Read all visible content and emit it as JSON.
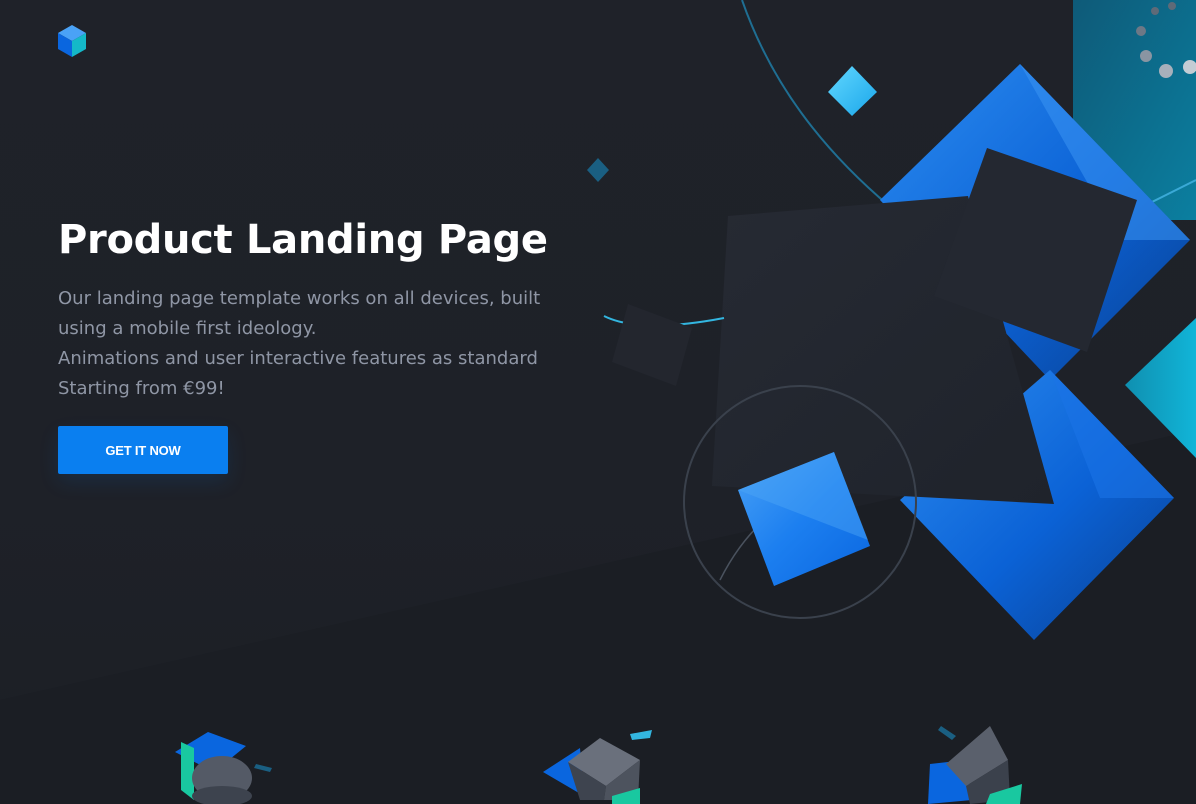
{
  "hero": {
    "title": "Product Landing Page",
    "lines": [
      "Our landing page template works on all devices, built",
      "using a mobile first ideology.",
      "Animations and user interactive features as standard",
      "Starting from €99!"
    ],
    "cta_label": "GET IT NOW"
  },
  "theme": {
    "background": "#1d2026",
    "accent": "#0a7ff0",
    "text_primary": "#ffffff",
    "text_secondary": "#8f96a5",
    "teal": "#14b8c8",
    "green": "#19c8a0"
  },
  "icons": {
    "logo": "cube-logo-icon"
  }
}
